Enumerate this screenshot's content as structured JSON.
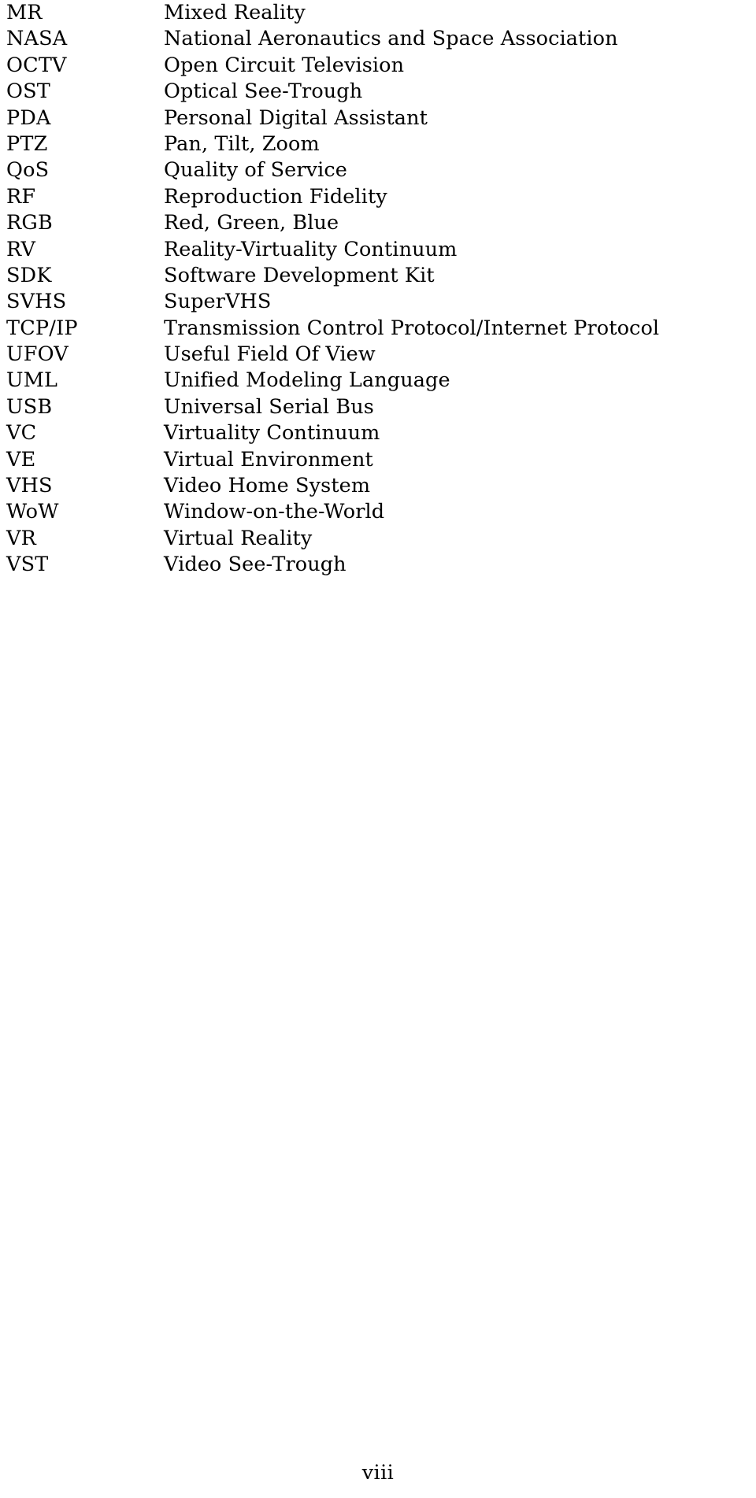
{
  "page": {
    "kind": "list-of-abbreviations",
    "page_number": "viii",
    "text_color": "#000000",
    "background_color": "#ffffff"
  },
  "columns": {
    "term_header": "",
    "definition_header": ""
  },
  "abbreviations": [
    {
      "term": "MR",
      "definition": "Mixed Reality"
    },
    {
      "term": "NASA",
      "definition": "National Aeronautics and Space Association"
    },
    {
      "term": "OCTV",
      "definition": "Open Circuit Television"
    },
    {
      "term": "OST",
      "definition": "Optical See-Trough"
    },
    {
      "term": "PDA",
      "definition": "Personal Digital Assistant"
    },
    {
      "term": "PTZ",
      "definition": "Pan, Tilt, Zoom"
    },
    {
      "term": "QoS",
      "definition": "Quality of Service"
    },
    {
      "term": "RF",
      "definition": "Reproduction Fidelity"
    },
    {
      "term": "RGB",
      "definition": "Red, Green, Blue"
    },
    {
      "term": "RV",
      "definition": "Reality-Virtuality Continuum"
    },
    {
      "term": "SDK",
      "definition": "Software Development Kit"
    },
    {
      "term": "SVHS",
      "definition": "SuperVHS"
    },
    {
      "term": "TCP/IP",
      "definition": "Transmission Control Protocol/Internet Protocol"
    },
    {
      "term": "UFOV",
      "definition": "Useful Field Of View"
    },
    {
      "term": "UML",
      "definition": "Unified Modeling Language"
    },
    {
      "term": "USB",
      "definition": "Universal Serial Bus"
    },
    {
      "term": "VC",
      "definition": "Virtuality Continuum"
    },
    {
      "term": "VE",
      "definition": "Virtual Environment"
    },
    {
      "term": "VHS",
      "definition": "Video Home System"
    },
    {
      "term": "WoW",
      "definition": "Window-on-the-World"
    },
    {
      "term": "VR",
      "definition": "Virtual Reality"
    },
    {
      "term": "VST",
      "definition": "Video See-Trough"
    }
  ]
}
